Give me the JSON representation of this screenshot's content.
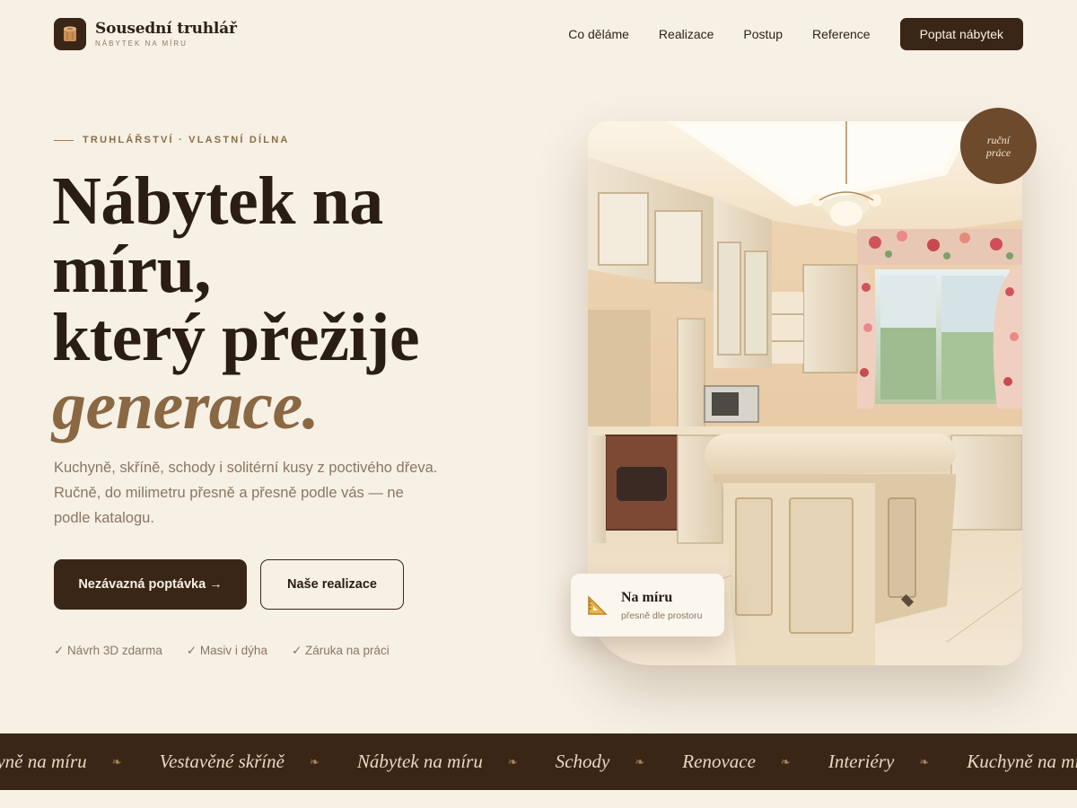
{
  "brand": {
    "name": "Sousední truhlář",
    "tagline": "NÁBYTEK NA MÍRU",
    "logo_icon": "wood-log-icon"
  },
  "nav": {
    "items": [
      "Co děláme",
      "Realizace",
      "Postup",
      "Reference"
    ],
    "cta": "Poptat nábytek"
  },
  "hero": {
    "eyebrow": "TRUHLÁŘSTVÍ · VLASTNÍ DÍLNA",
    "title_line1": "Nábytek na",
    "title_line2": "míru,",
    "title_line3": "který přežije",
    "title_accent": "generace.",
    "lead": "Kuchyně, skříně, schody i solitérní kusy z poctivého dřeva. Ručně, do milimetru přesně a přesně podle vás — ne podle katalogu.",
    "primary_button": "Nezávazná poptávka →",
    "secondary_button": "Naše realizace",
    "features": [
      "✓ Návrh 3D zdarma",
      "✓ Masiv i dýha",
      "✓ Záruka na práci"
    ]
  },
  "badge": {
    "line1": "ruční",
    "line2": "práce"
  },
  "info_card": {
    "icon": "triangle-ruler-icon",
    "title": "Na míru",
    "subtitle": "přesně dle prostoru"
  },
  "marquee": {
    "items": [
      "Kuchyně na míru",
      "Vestavěné skříně",
      "Nábytek na míru",
      "Schody",
      "Renovace",
      "Interiéry",
      "Kuchyně na míru"
    ],
    "separator": "❧"
  },
  "colors": {
    "background": "#f7f0e4",
    "dark_brown": "#3a2616",
    "accent": "#8a6843",
    "muted_text": "#8a7766"
  }
}
